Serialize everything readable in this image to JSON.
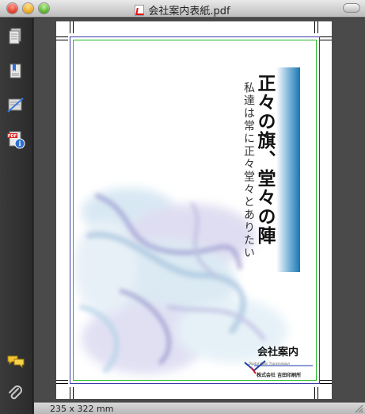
{
  "window": {
    "title": "会社案内表紙.pdf"
  },
  "sidebar": {
    "items": [
      {
        "icon": "document-icon"
      },
      {
        "icon": "bookmark-document-icon"
      },
      {
        "icon": "hide-annotations-icon"
      },
      {
        "icon": "pdf-info-icon"
      },
      {
        "icon": "comments-icon"
      },
      {
        "icon": "attachment-icon"
      }
    ]
  },
  "document": {
    "headline": "正々の旗、堂々の陣",
    "subtitle": "私達は常に正々堂々とありたい",
    "company_label": "会社案内",
    "printer_name": "株式会社 吉田印刷所",
    "logo_tagline": "Digital Color Transmission"
  },
  "status": {
    "page_size": "235 x 322 mm"
  },
  "colors": {
    "accent_blue": "#1a77b5",
    "trim_line": "#3b3ba8",
    "bleed_line": "#22bb22"
  }
}
